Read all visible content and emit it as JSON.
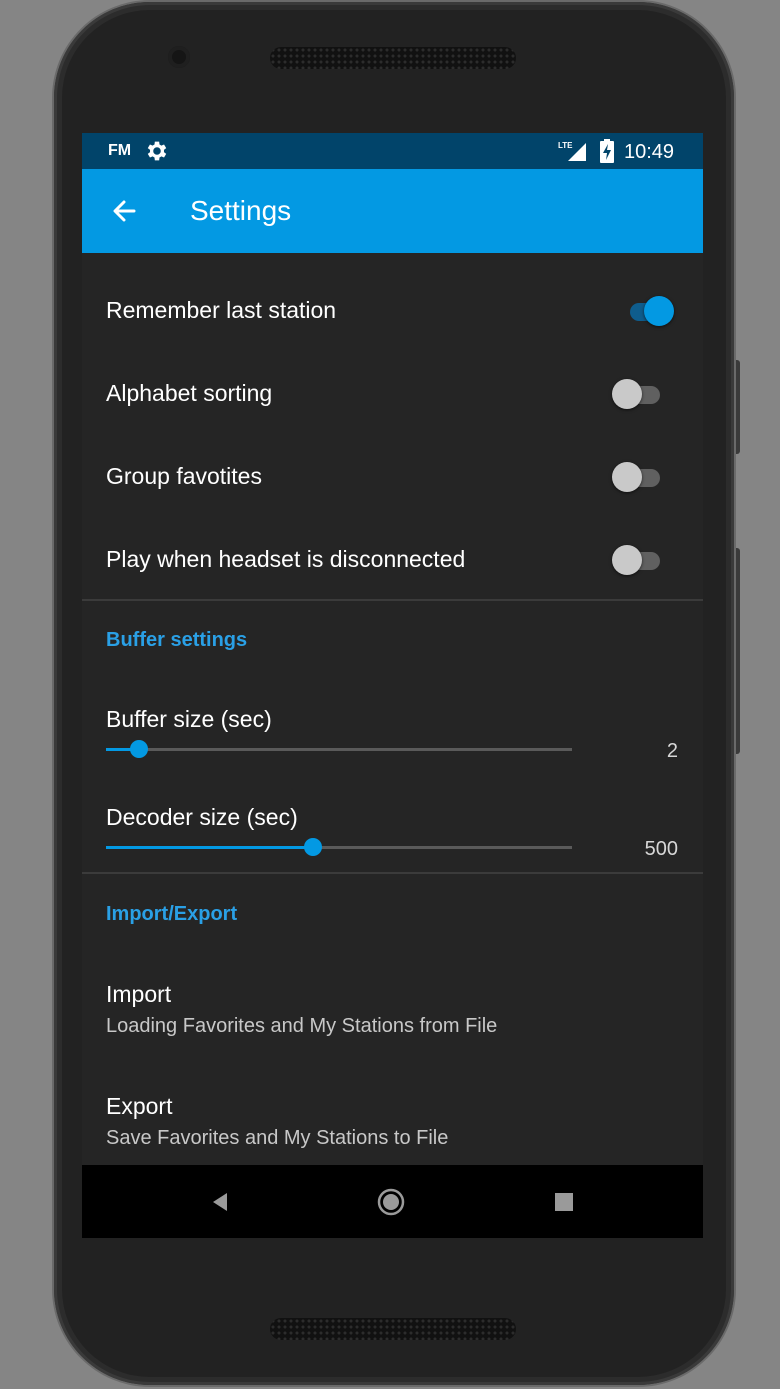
{
  "status_bar": {
    "app_indicator": "FM",
    "network": "LTE",
    "time": "10:49"
  },
  "app_bar": {
    "title": "Settings"
  },
  "toggles": [
    {
      "label": "Remember last station",
      "on": true
    },
    {
      "label": "Alphabet sorting",
      "on": false
    },
    {
      "label": "Group favotites",
      "on": false
    },
    {
      "label": "Play when headset is disconnected",
      "on": false
    }
  ],
  "buffer_section": {
    "title": "Buffer settings",
    "buffer_size": {
      "label": "Buffer size (sec)",
      "value": "2",
      "fraction": 0.07
    },
    "decoder_size": {
      "label": "Decoder size (sec)",
      "value": "500",
      "fraction": 0.445
    }
  },
  "import_export_section": {
    "title": "Import/Export",
    "import": {
      "label": "Import",
      "description": "Loading Favorites and My Stations from File"
    },
    "export": {
      "label": "Export",
      "description": "Save Favorites and My Stations to File"
    }
  },
  "colors": {
    "accent": "#0399e3",
    "statusbar": "#01446a",
    "background": "#252525"
  },
  "icons": [
    "gear-icon",
    "lte-signal-icon",
    "battery-charging-icon",
    "back-arrow-icon",
    "nav-back-icon",
    "nav-home-icon",
    "nav-recents-icon"
  ]
}
